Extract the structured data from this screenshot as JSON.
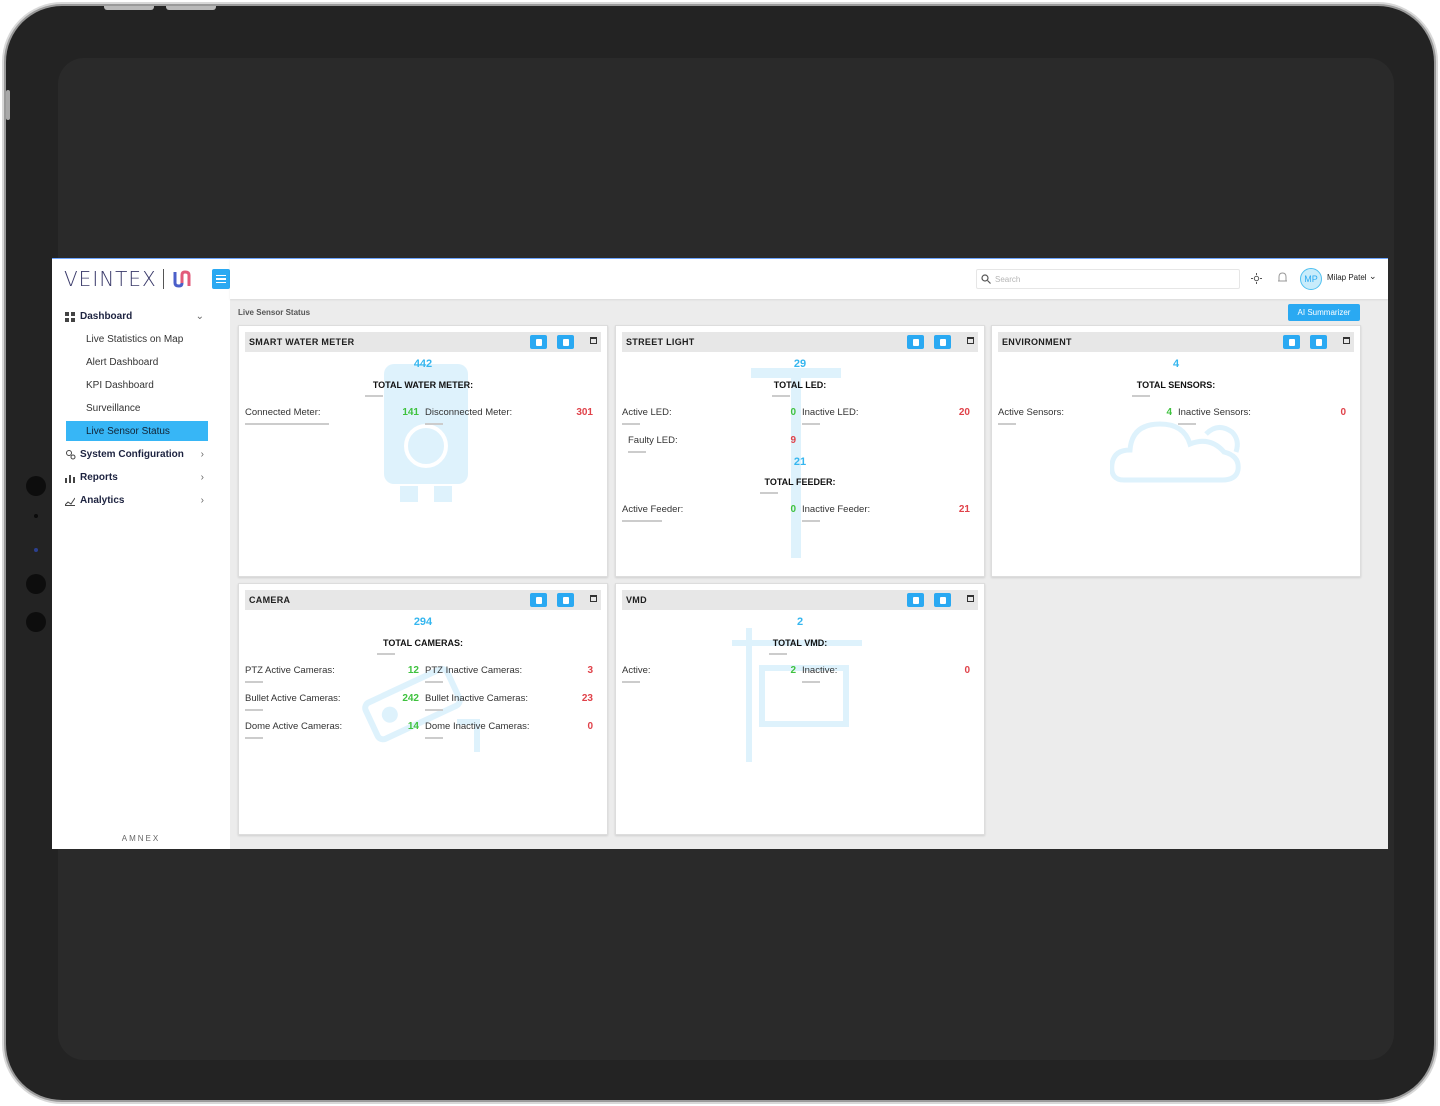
{
  "brand": {
    "name": "VEINTEX",
    "footer": "AMNEX"
  },
  "topbar": {
    "search_placeholder": "Search",
    "user_initials": "MP",
    "user_name": "Milap Patel"
  },
  "sidebar": {
    "dashboard": "Dashboard",
    "sub_items": [
      "Live Statistics on Map",
      "Alert Dashboard",
      "KPI Dashboard",
      "Surveillance",
      "Live Sensor Status"
    ],
    "system_configuration": "System Configuration",
    "reports": "Reports",
    "analytics": "Analytics"
  },
  "page": {
    "breadcrumb": "Live Sensor Status",
    "ai_button": "AI Summarizer"
  },
  "cards": {
    "water": {
      "title": "SMART WATER METER",
      "total_value": "442",
      "total_label": "TOTAL WATER METER:",
      "connected_label": "Connected Meter:",
      "connected_value": "141",
      "disconnected_label": "Disconnected Meter:",
      "disconnected_value": "301"
    },
    "street": {
      "title": "STREET LIGHT",
      "led_total": "29",
      "led_label": "TOTAL LED:",
      "active_led_label": "Active LED:",
      "active_led_value": "0",
      "inactive_led_label": "Inactive LED:",
      "inactive_led_value": "20",
      "faulty_led_label": "Faulty LED:",
      "faulty_led_value": "9",
      "feeder_total": "21",
      "feeder_label": "TOTAL FEEDER:",
      "active_feeder_label": "Active Feeder:",
      "active_feeder_value": "0",
      "inactive_feeder_label": "Inactive Feeder:",
      "inactive_feeder_value": "21"
    },
    "env": {
      "title": "ENVIRONMENT",
      "total_value": "4",
      "total_label": "TOTAL SENSORS:",
      "active_label": "Active Sensors:",
      "active_value": "4",
      "inactive_label": "Inactive Sensors:",
      "inactive_value": "0"
    },
    "camera": {
      "title": "CAMERA",
      "total_value": "294",
      "total_label": "TOTAL CAMERAS:",
      "ptz_active_label": "PTZ Active Cameras:",
      "ptz_active_value": "12",
      "ptz_inactive_label": "PTZ Inactive Cameras:",
      "ptz_inactive_value": "3",
      "bullet_active_label": "Bullet Active Cameras:",
      "bullet_active_value": "242",
      "bullet_inactive_label": "Bullet Inactive Cameras:",
      "bullet_inactive_value": "23",
      "dome_active_label": "Dome Active Cameras:",
      "dome_active_value": "14",
      "dome_inactive_label": "Dome Inactive Cameras:",
      "dome_inactive_value": "0"
    },
    "vmd": {
      "title": "VMD",
      "total_value": "2",
      "total_label": "TOTAL VMD:",
      "active_label": "Active:",
      "active_value": "2",
      "inactive_label": "Inactive:",
      "inactive_value": "0"
    }
  },
  "colors": {
    "accent": "#2aa9f2",
    "active": "#3fc23f",
    "inactive": "#e0424a",
    "total": "#35b6ef"
  }
}
